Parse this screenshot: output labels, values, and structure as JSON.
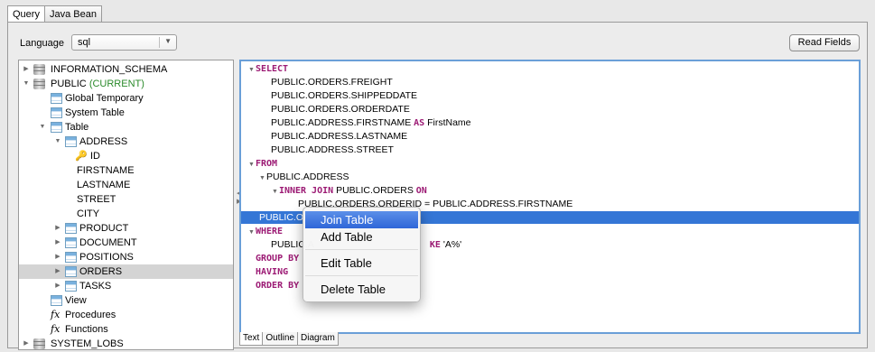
{
  "tabs": [
    "Query",
    "Java Bean"
  ],
  "language": {
    "label": "Language",
    "value": "sql"
  },
  "read_fields_label": "Read Fields",
  "tree": {
    "schema_info": "INFORMATION_SCHEMA",
    "schema_public": "PUBLIC",
    "schema_public_badge": "(CURRENT)",
    "global_temporary": "Global Temporary",
    "system_table": "System Table",
    "table": "Table",
    "address": "ADDRESS",
    "col_id": "ID",
    "col_firstname": "FIRSTNAME",
    "col_lastname": "LASTNAME",
    "col_street": "STREET",
    "col_city": "CITY",
    "product": "PRODUCT",
    "document": "DOCUMENT",
    "positions": "POSITIONS",
    "orders": "ORDERS",
    "tasks": "TASKS",
    "view": "View",
    "procedures": "Procedures",
    "functions": "Functions",
    "system_lobs": "SYSTEM_LOBS"
  },
  "sql": {
    "select": "SELECT",
    "f_freight": "PUBLIC.ORDERS.FREIGHT",
    "f_shippeddate": "PUBLIC.ORDERS.SHIPPEDDATE",
    "f_orderdate": "PUBLIC.ORDERS.ORDERDATE",
    "f_firstname": "PUBLIC.ADDRESS.FIRSTNAME",
    "as": "AS",
    "alias_firstname": "FirstName",
    "f_lastname": "PUBLIC.ADDRESS.LASTNAME",
    "f_street": "PUBLIC.ADDRESS.STREET",
    "from": "FROM",
    "from_table": "PUBLIC.ADDRESS",
    "inner_join": "INNER JOIN",
    "join_table": "PUBLIC.ORDERS",
    "on": "ON",
    "join_condition": "PUBLIC.ORDERS.ORDERID = PUBLIC.ADDRESS.FIRSTNAME",
    "highlighted": "PUBLIC.ORDERS",
    "where": "WHERE",
    "where_left": "PUBLIC.A",
    "like_kw": "KE",
    "like_val": "'A%'",
    "group_by": "GROUP BY",
    "having": "HAVING",
    "order_by": "ORDER BY"
  },
  "bottom_tabs": [
    "Text",
    "Outline",
    "Diagram"
  ],
  "context_menu": [
    "Join Table",
    "Add Table",
    "Edit Table",
    "Delete Table"
  ]
}
